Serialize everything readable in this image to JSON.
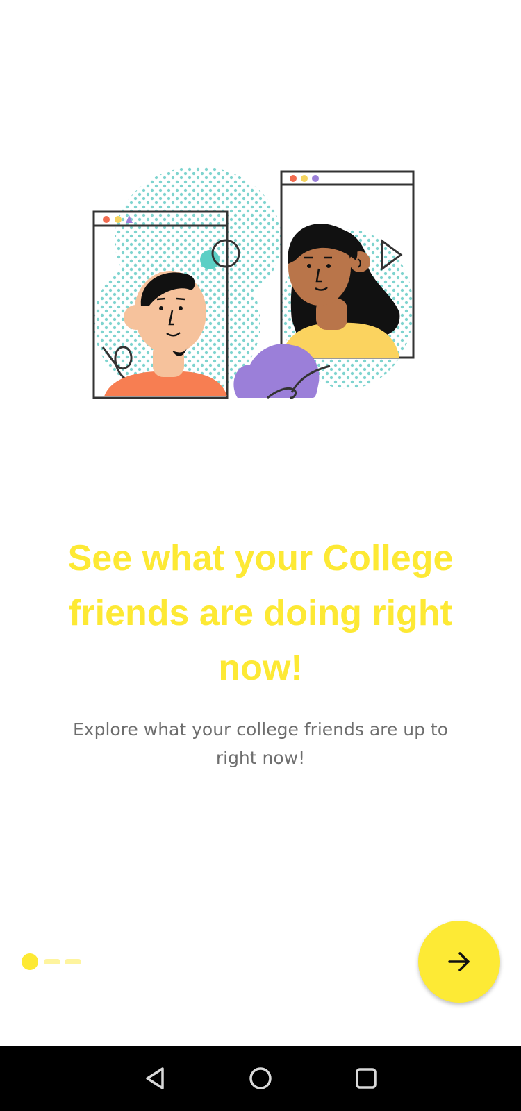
{
  "onboarding": {
    "headline": "See what your College friends are doing right now!",
    "subtitle": "Explore what your college friends are up to right now!",
    "page_indicator": {
      "current_page": 1,
      "total_pages": 3
    },
    "next_button": {
      "icon": "arrow-right-icon"
    }
  },
  "system_nav": {
    "buttons": [
      "back-icon",
      "home-icon",
      "recents-icon"
    ]
  },
  "colors": {
    "accent": "#fde934",
    "accent_light": "#fef49e",
    "subtitle": "#6e6e6e",
    "nav_background": "#000000"
  }
}
